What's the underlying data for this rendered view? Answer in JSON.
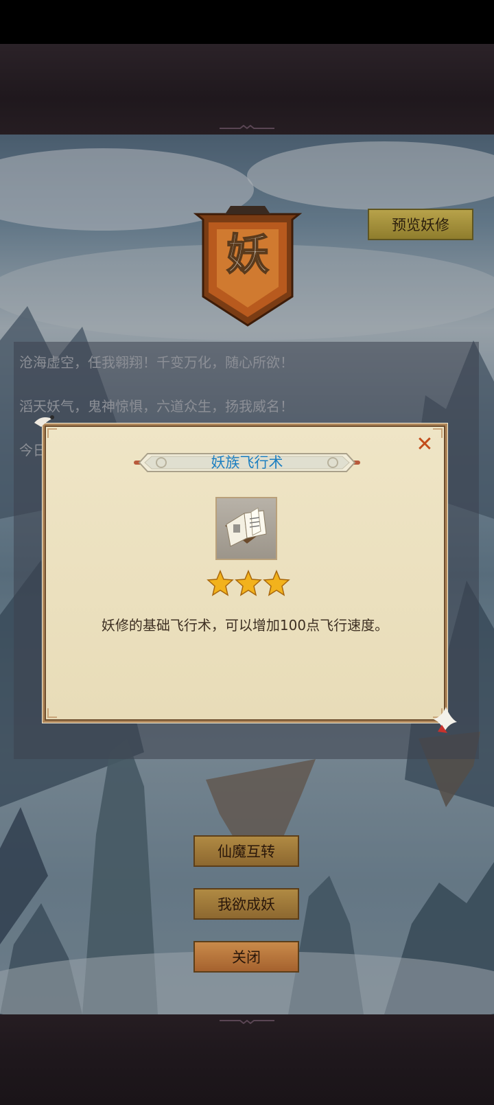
{
  "header": {
    "preview_button": "预览妖修"
  },
  "emblem": {
    "character": "妖"
  },
  "intro": {
    "lines": [
      "沧海虚空，任我翱翔！千变万化，随心所欲！",
      "滔天妖气，鬼神惊惧，六道众生，扬我威名！",
      "今日"
    ]
  },
  "popup": {
    "title": "妖族飞行术",
    "close_symbol": "✕",
    "item_icon": "book-icon",
    "stars": 3,
    "description": "妖修的基础飞行术，可以增加100点飞行速度。"
  },
  "menu": {
    "switch_label": "仙魔互转",
    "become_label": "我欲成妖",
    "close_label": "关闭"
  },
  "colors": {
    "title_blue": "#1d7fc0",
    "close_red": "#c24c1a",
    "button_gold": "#b08a43"
  }
}
